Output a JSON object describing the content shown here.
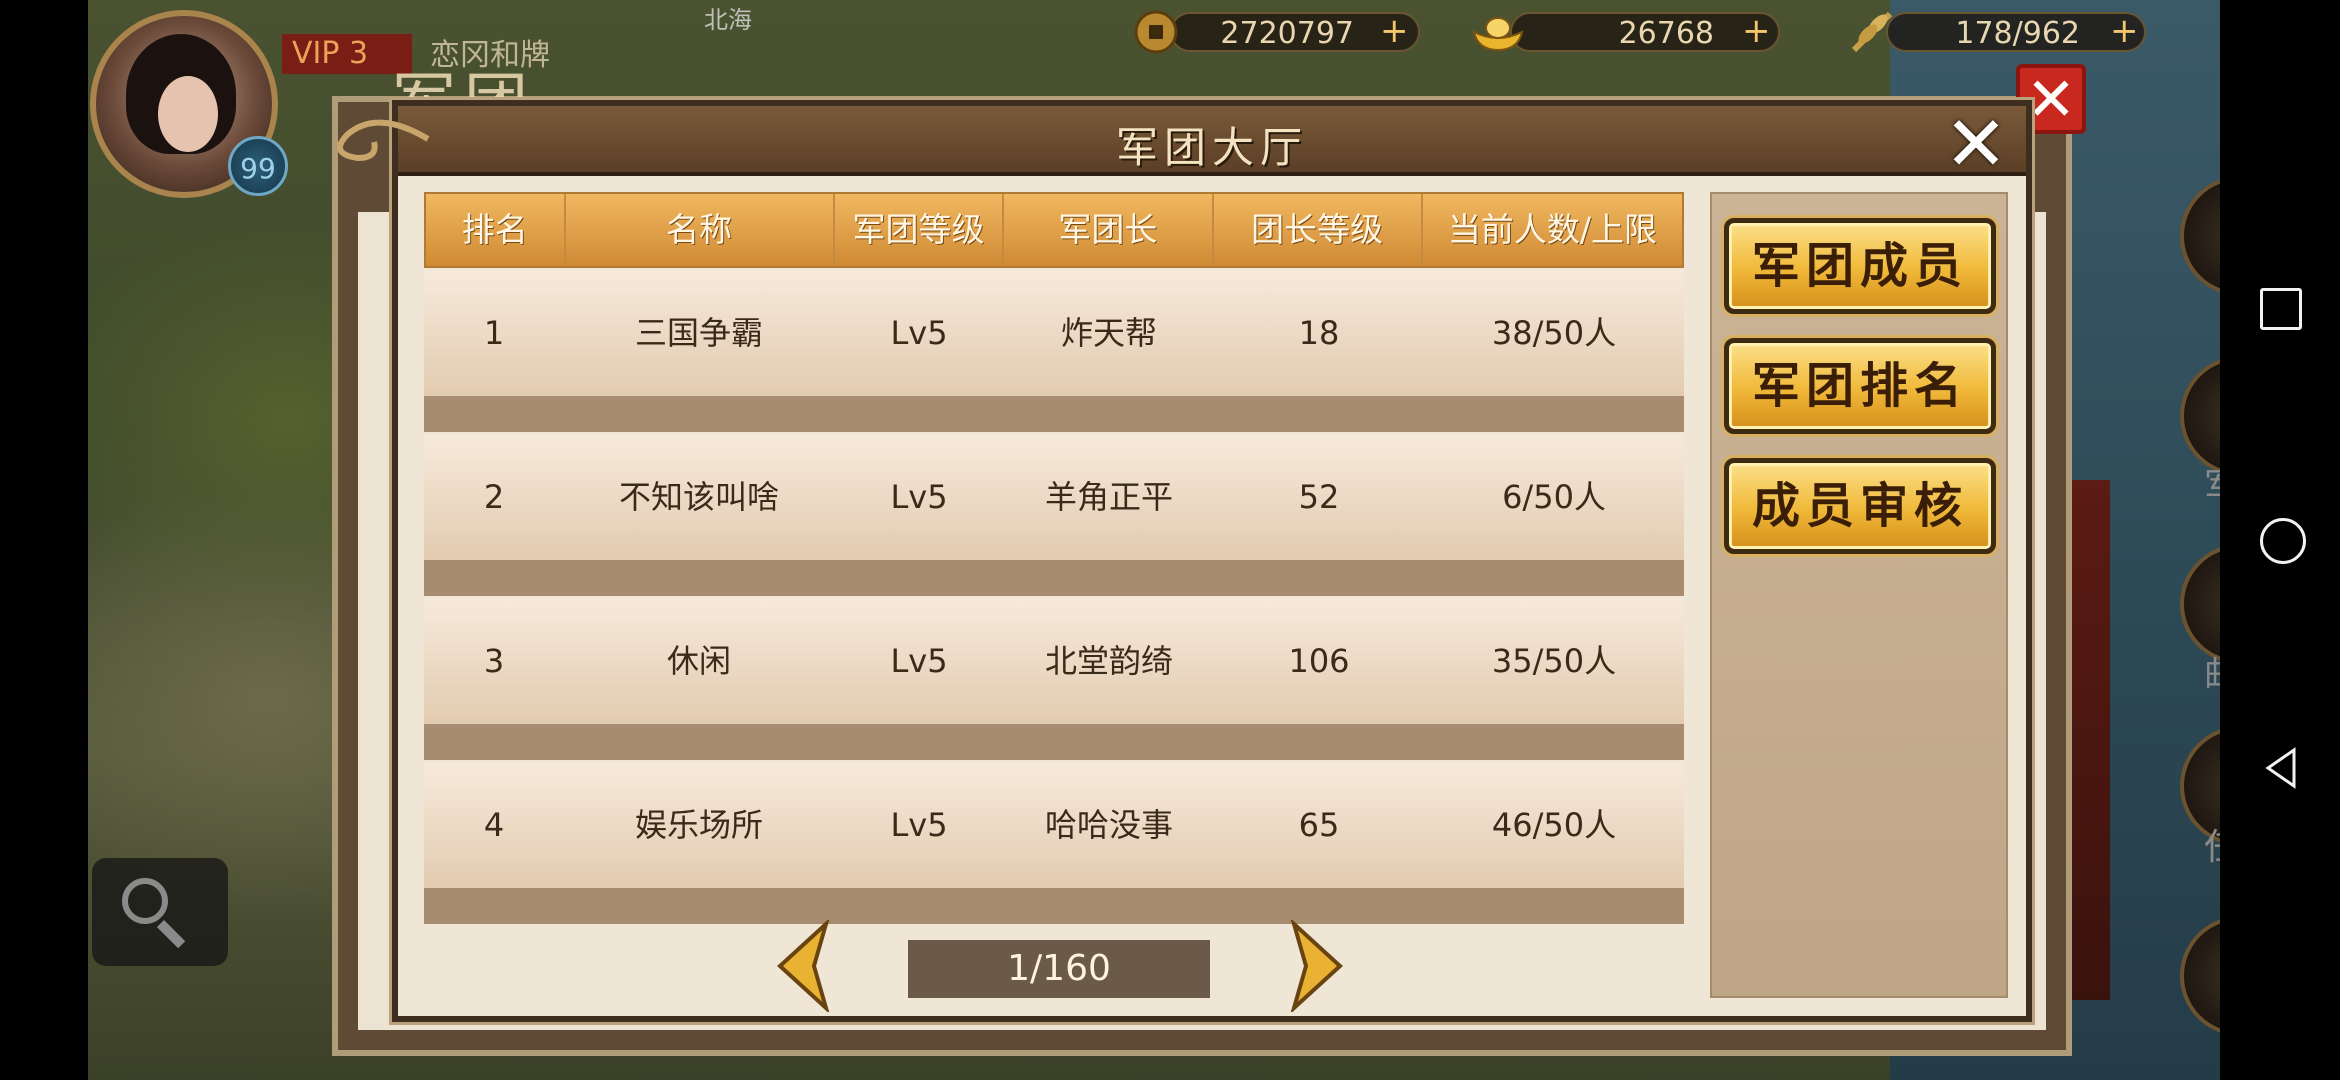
{
  "hud": {
    "vip": "VIP 3",
    "level": "99",
    "topbar_name": "恋冈和牌",
    "map_label": "北海",
    "coins": "2720797",
    "gold": "26768",
    "food": "178/962",
    "outer_title": "军团"
  },
  "side_menu": {
    "legion": "军团",
    "mail": "邮件",
    "quest": "任务"
  },
  "dialog": {
    "title": "军团大厅",
    "headers": [
      "排名",
      "名称",
      "军团等级",
      "军团长",
      "团长等级",
      "当前人数/上限"
    ],
    "rows": [
      {
        "rank": "1",
        "name": "三国争霸",
        "level": "Lv5",
        "leader": "炸天帮",
        "leader_level": "18",
        "members": "38/50人"
      },
      {
        "rank": "2",
        "name": "不知该叫啥",
        "level": "Lv5",
        "leader": "羊角正平",
        "leader_level": "52",
        "members": "6/50人"
      },
      {
        "rank": "3",
        "name": "休闲",
        "level": "Lv5",
        "leader": "北堂韵绮",
        "leader_level": "106",
        "members": "35/50人"
      },
      {
        "rank": "4",
        "name": "娱乐场所",
        "level": "Lv5",
        "leader": "哈哈没事",
        "leader_level": "65",
        "members": "46/50人"
      }
    ],
    "page": "1/160",
    "buttons": {
      "members": "军团成员",
      "ranking": "军团排名",
      "review": "成员审核"
    }
  },
  "colors": {
    "header_gold": "#d08a34",
    "button_gold": "#f0b838",
    "frame_brown": "#5b3f26"
  }
}
